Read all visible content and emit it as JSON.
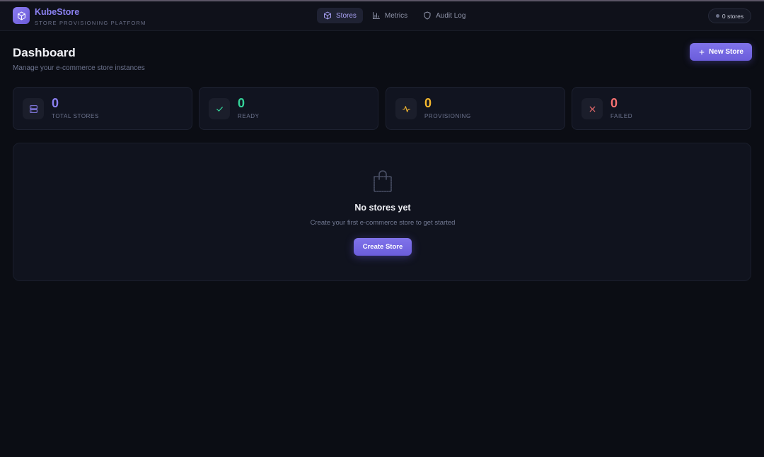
{
  "brand": {
    "name": "KubeStore",
    "tagline": "STORE PROVISIONING PLATFORM",
    "logo_icon": "cube-icon"
  },
  "nav": {
    "items": [
      {
        "label": "Stores",
        "icon": "cube-icon",
        "active": true
      },
      {
        "label": "Metrics",
        "icon": "bar-chart-icon",
        "active": false
      },
      {
        "label": "Audit Log",
        "icon": "shield-icon",
        "active": false
      }
    ],
    "store_count": "0 stores"
  },
  "header": {
    "title": "Dashboard",
    "subtitle": "Manage your e-commerce store instances",
    "new_store_label": "New Store"
  },
  "stats": [
    {
      "value": "0",
      "label": "TOTAL STORES",
      "icon": "server-icon",
      "color": "#8b80f0"
    },
    {
      "value": "0",
      "label": "READY",
      "icon": "check-icon",
      "color": "#34d399"
    },
    {
      "value": "0",
      "label": "PROVISIONING",
      "icon": "activity-icon",
      "color": "#f5b82e"
    },
    {
      "value": "0",
      "label": "FAILED",
      "icon": "x-icon",
      "color": "#f87171"
    }
  ],
  "empty_state": {
    "title": "No stores yet",
    "subtitle": "Create your first e-commerce store to get started",
    "button_label": "Create Store",
    "icon": "shopping-bag-icon"
  },
  "colors": {
    "accent": "#7c6fe8",
    "background": "#0b0d14"
  }
}
